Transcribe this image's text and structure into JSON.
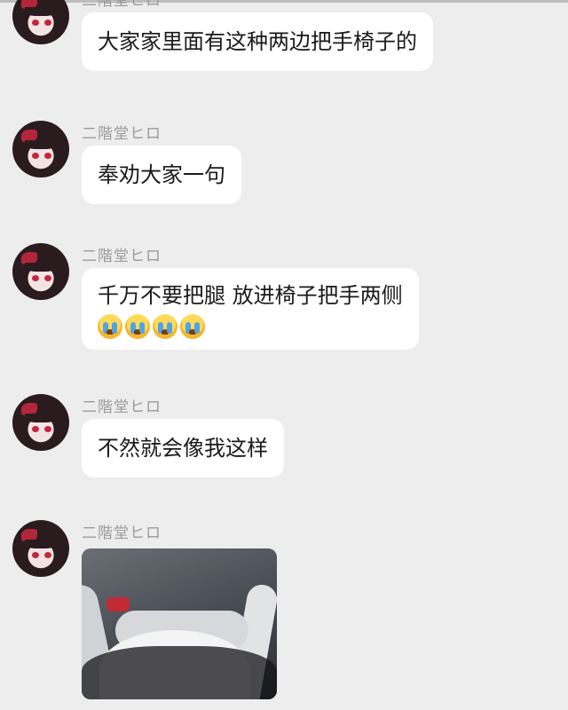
{
  "messages": [
    {
      "sender": "二階堂ヒロ",
      "text": "大家家里面有这种两边把手椅子的"
    },
    {
      "sender": "二階堂ヒロ",
      "text": "奉劝大家一句"
    },
    {
      "sender": "二階堂ヒロ",
      "text": "千万不要把腿 放进椅子把手两侧",
      "emoji": [
        "😭",
        "😭",
        "😭",
        "😭"
      ]
    },
    {
      "sender": "二階堂ヒロ",
      "text": "不然就会像我这样"
    },
    {
      "sender": "二階堂ヒロ",
      "image": "photo"
    }
  ],
  "colors": {
    "background": "#ededed",
    "bubble": "#ffffff",
    "name": "#9a9a9a",
    "text": "#1a1a1a"
  }
}
